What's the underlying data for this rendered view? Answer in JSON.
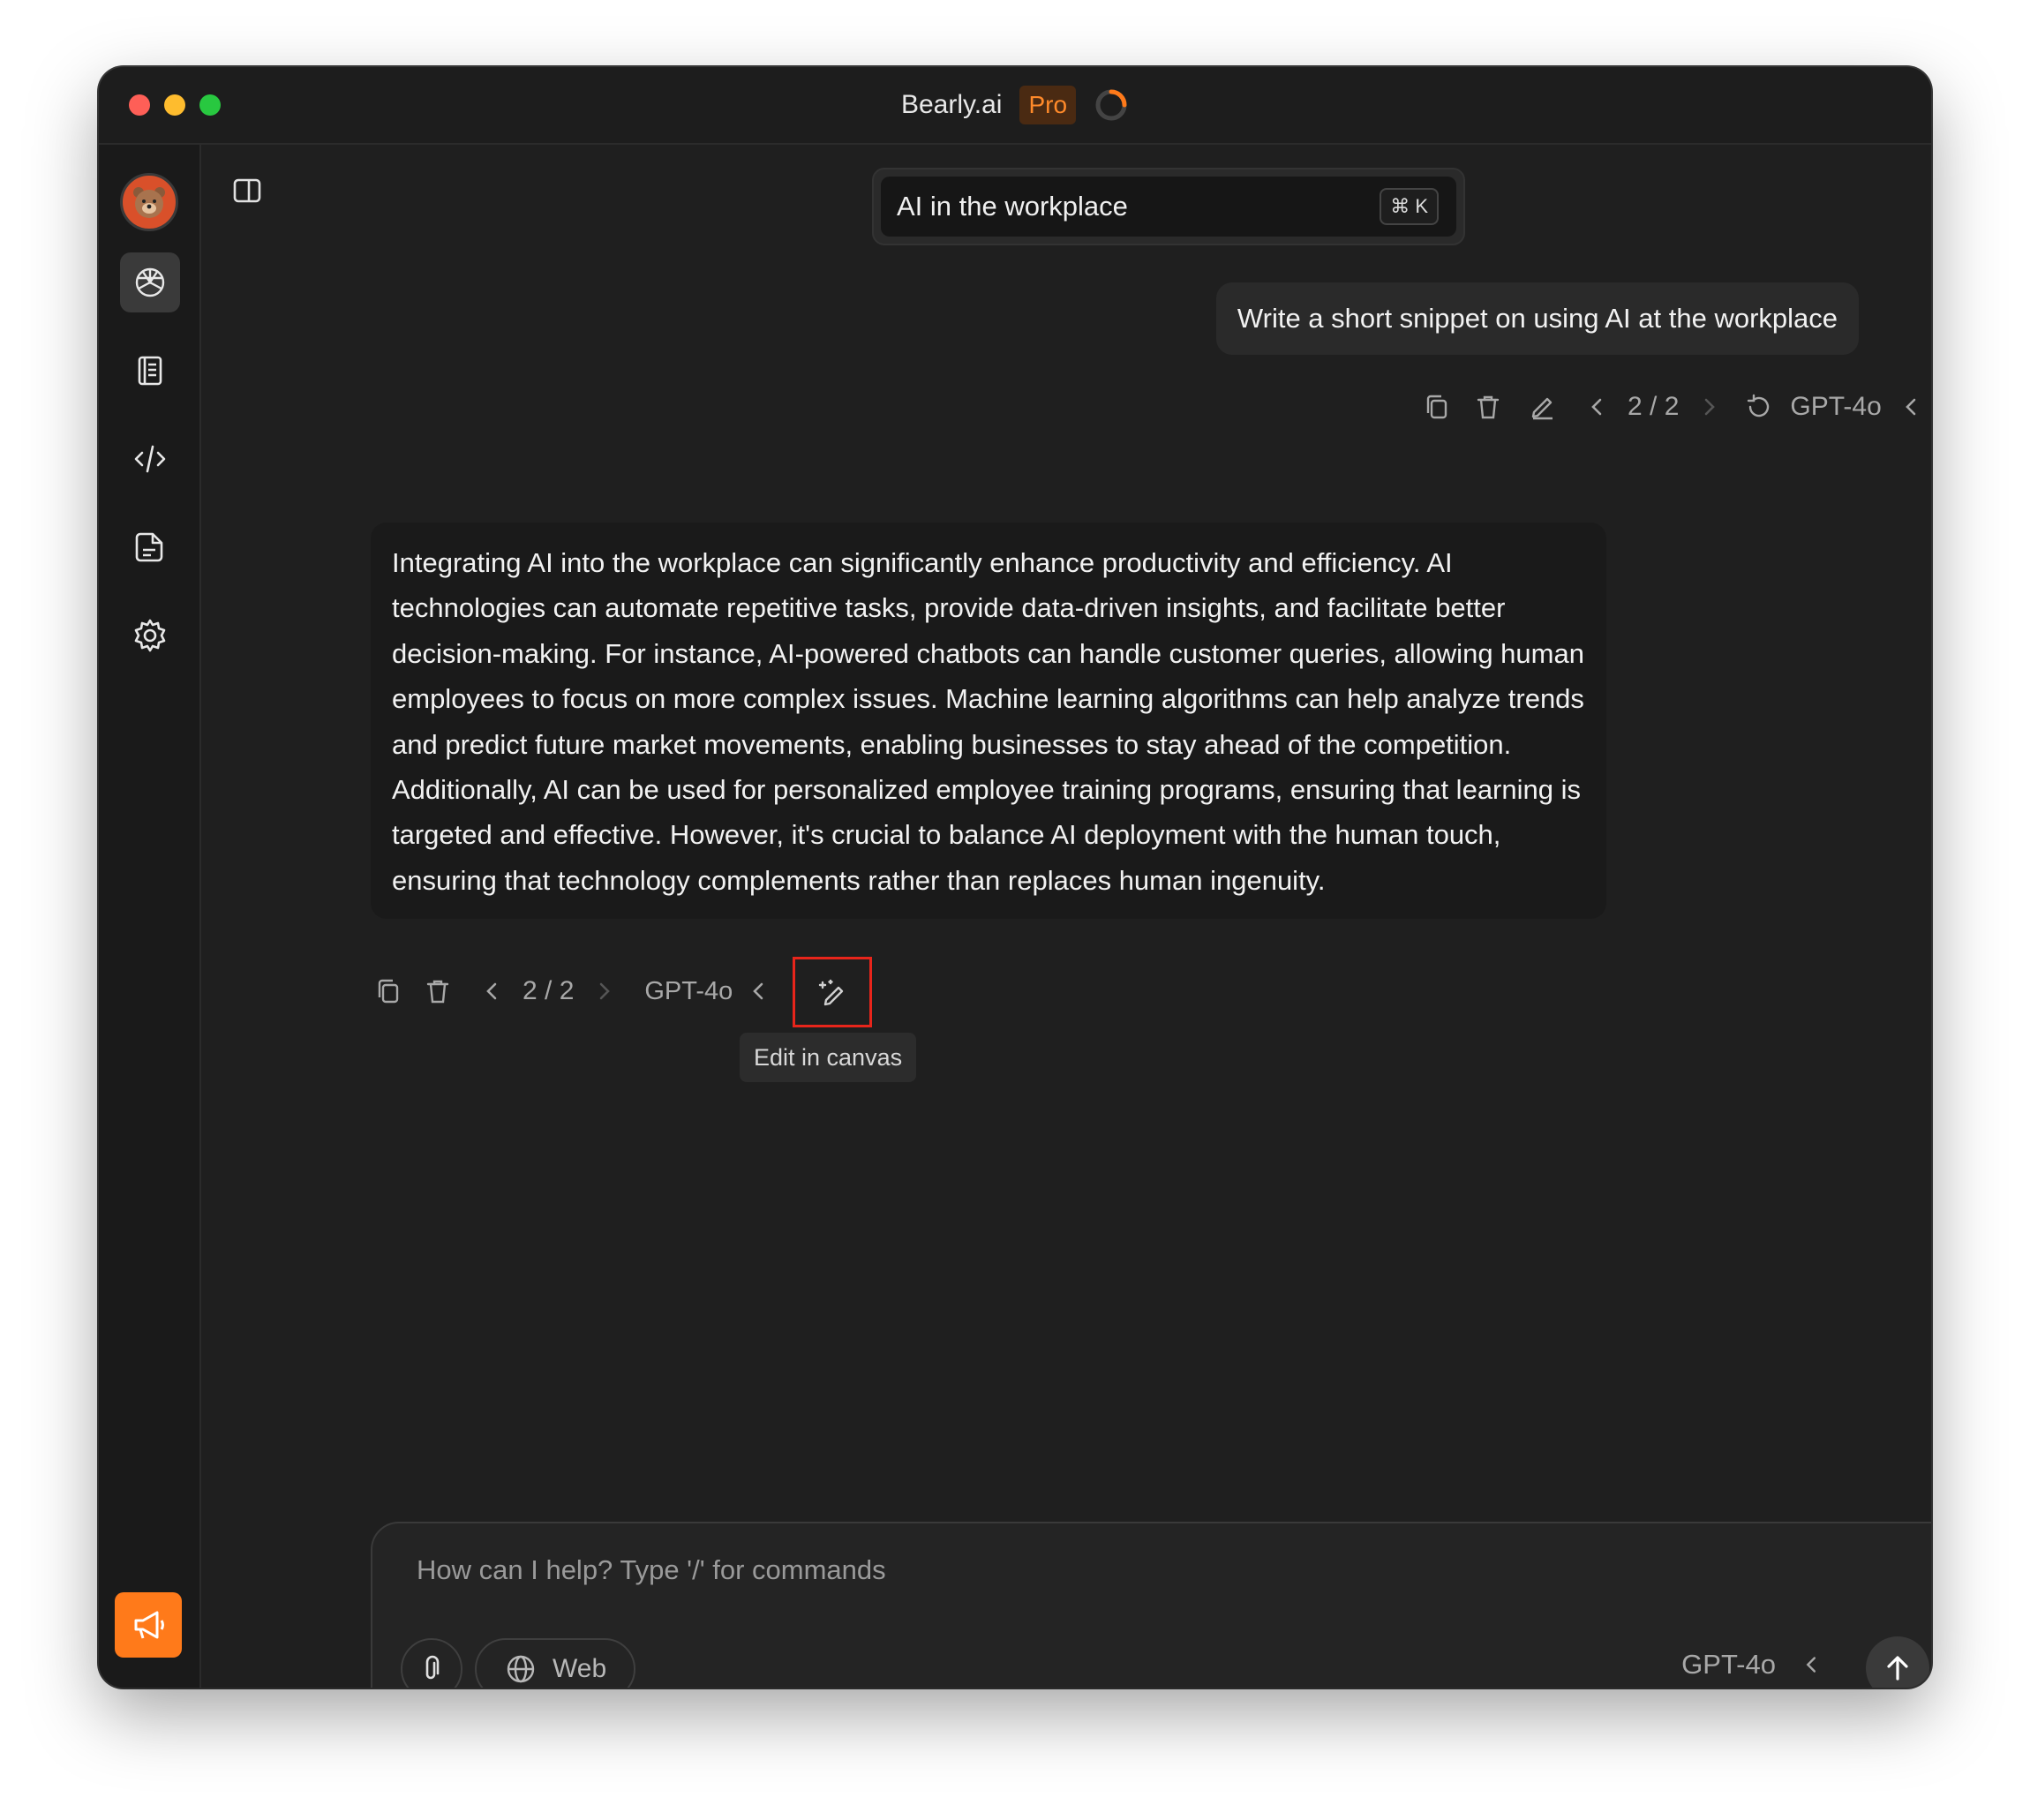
{
  "window": {
    "app_title": "Bearly.ai",
    "pro_badge": "Pro"
  },
  "sidebar": {
    "items": [
      {
        "name": "chat",
        "icon": "openai-logo-icon",
        "active": true
      },
      {
        "name": "notebook",
        "icon": "notebook-icon"
      },
      {
        "name": "code",
        "icon": "code-icon"
      },
      {
        "name": "documents",
        "icon": "document-icon"
      },
      {
        "name": "settings",
        "icon": "gear-icon"
      }
    ],
    "announce_icon": "megaphone-icon"
  },
  "header": {
    "conversation_title": "AI in the workplace",
    "shortcut": "⌘ K"
  },
  "user_message": {
    "text": "Write a short snippet on using AI at the workplace",
    "pager": "2 / 2",
    "model": "GPT-4o"
  },
  "ai_message": {
    "text": "Integrating AI into the workplace can significantly enhance productivity and efficiency. AI technologies can automate repetitive tasks, provide data-driven insights, and facilitate better decision-making. For instance, AI-powered chatbots can handle customer queries, allowing human employees to focus on more complex issues. Machine learning algorithms can help analyze trends and predict future market movements, enabling businesses to stay ahead of the competition. Additionally, AI can be used for personalized employee training programs, ensuring that learning is targeted and effective. However, it's crucial to balance AI deployment with the human touch, ensuring that technology complements rather than replaces human ingenuity.",
    "pager": "2 / 2",
    "model": "GPT-4o",
    "canvas_tooltip": "Edit in canvas"
  },
  "composer": {
    "placeholder": "How can I help? Type '/' for commands",
    "web_label": "Web",
    "model": "GPT-4o"
  },
  "colors": {
    "accent": "#ff7a1a",
    "background": "#1f1f1f",
    "highlight": "#e8251b"
  }
}
